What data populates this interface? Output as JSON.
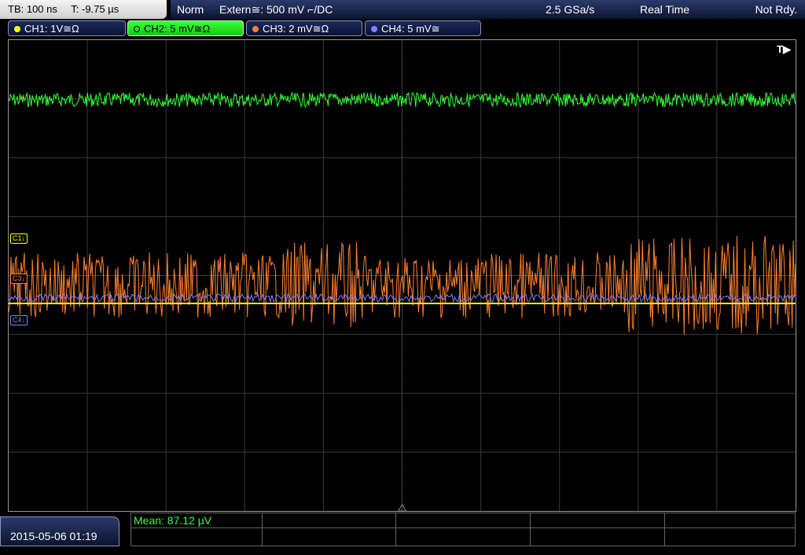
{
  "timebase": {
    "tb": "TB: 100 ns",
    "trigger_time": "T: -9.75 µs"
  },
  "status": {
    "mode": "Norm",
    "trigger_source": "Extern≅: 500 mV ⌐/DC",
    "sample_rate": "2.5 GSa/s",
    "acq_mode": "Real Time",
    "state": "Not Rdy."
  },
  "channels": [
    {
      "label": "CH1: 1V≅Ω",
      "color": "#ffff00",
      "active": false
    },
    {
      "label": "CH2: 5 mV≅Ω",
      "color": "#33ff33",
      "active": true
    },
    {
      "label": "CH3: 2 mV≅Ω",
      "color": "#ff8030",
      "active": false
    },
    {
      "label": "CH4: 5 mV≅",
      "color": "#8080ff",
      "active": false
    }
  ],
  "trigger_marker": "T▶",
  "ref_markers": {
    "c1": "C1↓",
    "c3": "C3↓",
    "c4": "C4↓"
  },
  "datetime": "2015-05-06 01:19",
  "measurement": {
    "mean": "Mean: 87.12 µV"
  },
  "colors": {
    "ch1": "#ffff00",
    "ch2": "#33ff33",
    "ch3": "#ff8030",
    "ch4": "#8080ff",
    "grid": "#3a3a3a"
  }
}
